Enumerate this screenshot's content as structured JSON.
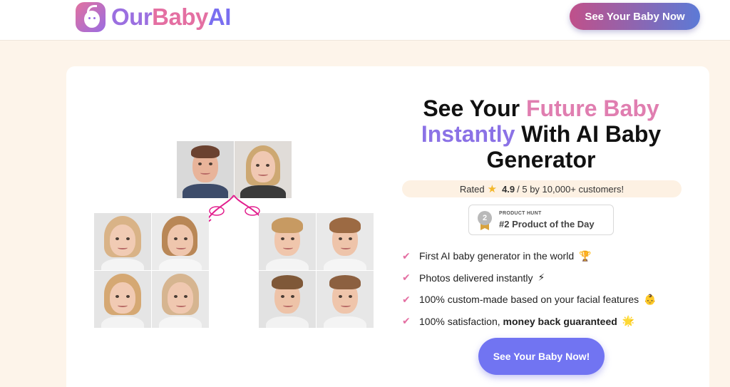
{
  "brand": {
    "part1": "Our",
    "part2": "Baby",
    "part3": "AI"
  },
  "header": {
    "cta_label": "See Your Baby Now"
  },
  "hero": {
    "title_part1": "See Your ",
    "title_highlight1": "Future Baby",
    "title_highlight2": "Instantly",
    "title_part2": " With AI Baby Generator",
    "rating_prefix": "Rated",
    "rating_value": "4.9",
    "rating_suffix": "/ 5 by 10,000+ customers!",
    "badge_top": "PRODUCT HUNT",
    "badge_main": "#2 Product of the Day",
    "badge_rank": "2",
    "features": [
      {
        "text": "First AI baby generator in the world",
        "emoji": "🏆"
      },
      {
        "text": "Photos delivered instantly",
        "emoji": "⚡"
      },
      {
        "text": "100% custom-made based on your facial features",
        "emoji": "👶"
      },
      {
        "text": "100% satisfaction, ",
        "bold": "money back guaranteed",
        "emoji": "🌟"
      }
    ],
    "cta_label": "See Your Baby Now!"
  },
  "colors": {
    "accent_pink": "#e46fa2",
    "accent_purple": "#7174f2",
    "page_bg": "#fdf4ea"
  }
}
